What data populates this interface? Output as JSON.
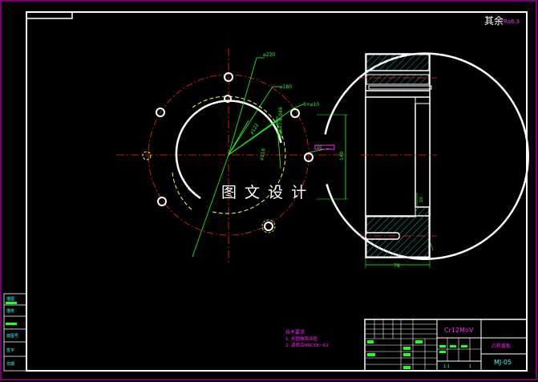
{
  "surface_note": "其余",
  "surface_symbol": "Ra6.3",
  "watermark": "图 文 设 计",
  "dims": {
    "outer_dia": "⌀230",
    "bolt_circle": "⌀180",
    "hole_callout": "6×⌀10",
    "bore": "⌀122",
    "counterbore": "⌀116",
    "tolerance_note": "⌀56H7-0.046",
    "section_height": "140",
    "width": "78",
    "step": "10"
  },
  "notes": {
    "heading": "技术要求",
    "line1": "1. 外圆做铬涂层",
    "line2": "2. 调质后HRC58~62"
  },
  "title_block": {
    "material": "Cr12MoV",
    "part_name": "凸轮盖板",
    "drawing_no": "MJ-05",
    "scale": "1:1",
    "qty": "1"
  },
  "side_table": {
    "r1": "描图",
    "r2": "描校",
    "r3": "底图号",
    "r4": "签字",
    "r5": "日期"
  },
  "colors": {
    "frame": "#ffffff",
    "border": "#c000c0",
    "center": "#ff2020",
    "dim": "#20ff20",
    "hidden": "#ffff40",
    "hatch": "#20a8a8",
    "cyan": "#40ffff",
    "highlight": "#ff20ff"
  }
}
